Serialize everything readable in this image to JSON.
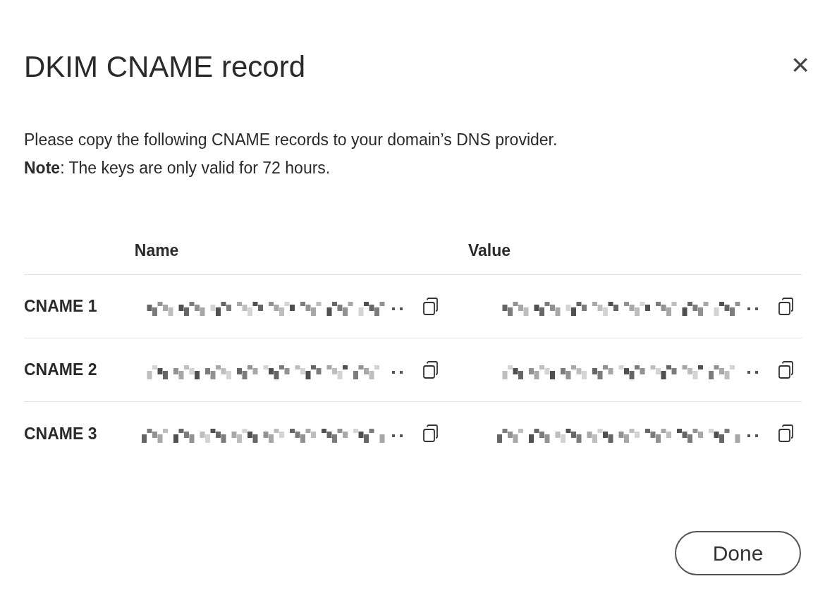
{
  "dialog": {
    "title": "DKIM CNAME record",
    "close": "×",
    "description": "Please copy the following CNAME records to your domain’s DNS provider.",
    "note": "**Note**: The keys are only valid for 72 hours."
  },
  "table": {
    "columns": [
      "Name",
      "Value"
    ],
    "rows": [
      {
        "label": "CNAME 1",
        "name": {
          "kind": "redacted"
        },
        "value": {
          "kind": "redacted"
        }
      },
      {
        "label": "CNAME 2",
        "name": {
          "kind": "redacted"
        },
        "value": {
          "kind": "redacted"
        }
      },
      {
        "label": "CNAME 3",
        "name": {
          "kind": "redacted"
        },
        "value": {
          "kind": "redacted"
        }
      }
    ]
  },
  "buttons": [
    "Done"
  ]
}
